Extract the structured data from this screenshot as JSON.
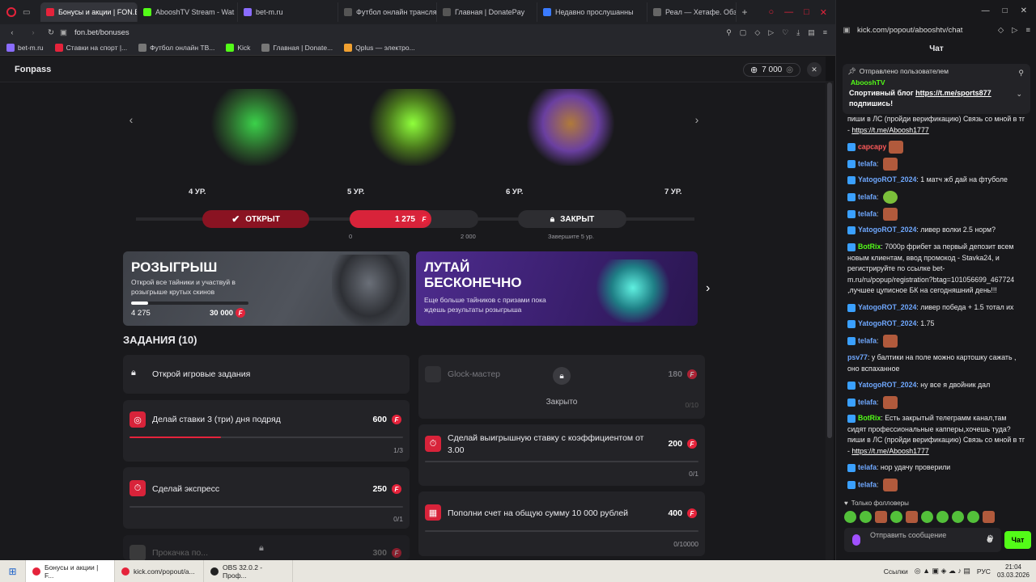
{
  "browser_tabs": [
    {
      "label": "Бонусы и акции | FON.BE",
      "color": "#e5233b",
      "active": true
    },
    {
      "label": "AbooshTV Stream - Wat",
      "color": "#53fc18"
    },
    {
      "label": "bet-m.ru",
      "color": "#8a6cff"
    },
    {
      "label": "Футбол онлайн трансля",
      "color": "#2c2d32"
    },
    {
      "label": "Главная | DonatePay",
      "color": "#2c2d32"
    },
    {
      "label": "Недавно прослушанны",
      "color": "#3a7bff"
    },
    {
      "label": "Реал — Хетафе. Обзор и",
      "color": "#444"
    }
  ],
  "url": "fon.bet/bonuses",
  "bookmarks": [
    "bet-m.ru",
    "Ставки на спорт |...",
    "Футбол онлайн ТВ...",
    "Kick",
    "Главная | Donate...",
    "Qplus — электро..."
  ],
  "page": {
    "title": "Fonpass",
    "balance": "7 000",
    "levels": [
      "4 УР.",
      "5 УР.",
      "6 УР.",
      "7 УР."
    ],
    "opened_label": "ОТКРЫТ",
    "current_points": "1 275",
    "closed_label": "ЗАКРЫТ",
    "range_min": "0",
    "range_max": "2 000",
    "closed_hint": "Завершите 5 ур.",
    "banner1": {
      "title": "РОЗЫГРЫШ",
      "text": "Открой все тайники и участвуй в розыгрыше крутых скинов",
      "progress_value": "4 275",
      "progress_max": "30 000",
      "progress_fraction": 0.1425
    },
    "banner2": {
      "title1": "ЛУТАЙ",
      "title2": "БЕСКОНЕЧНО",
      "text": "Еще больше тайников с призами пока ждешь результаты розыгрыша"
    },
    "tasks_title": "ЗАДАНИЯ (10)",
    "unlock_tasks": "Открой игровые задания",
    "locked_task": {
      "title": "Glock-мастер",
      "points": "180",
      "status": "Закрыто",
      "count": "0/10"
    },
    "tasks": [
      {
        "title": "Делай ставки 3 (три) дня подряд",
        "points": "600",
        "count": "1/3",
        "fraction": 0.333
      },
      {
        "title": "Сделай выигрышную ставку с коэффициентом от 3.00",
        "points": "200",
        "count": "0/1",
        "fraction": 0
      },
      {
        "title": "Сделай экспресс",
        "points": "250",
        "count": "0/1",
        "fraction": 0
      },
      {
        "title": "Пополни счет на общую сумму 10 000 рублей",
        "points": "400",
        "count": "0/10000",
        "fraction": 0
      },
      {
        "title": "Прокачка по...",
        "points": "300"
      }
    ]
  },
  "chat": {
    "url": "kick.com/popout/abooshtv/chat",
    "header": "Чат",
    "pinned_by": "Отправлено пользователем",
    "pinned_user": "AbooshTV",
    "pinned_text": "Спортивный блог ",
    "pinned_link": "https://t.me/sports877",
    "pinned_text2": "подпишись!",
    "top_text": "пиши в ЛС (пройди верификацию) Связь со мной в тг - ",
    "top_link": "https://t.me/Aboosh1777",
    "messages": [
      {
        "user": "capcapy",
        "text": ""
      },
      {
        "user": "telafa",
        "text": ""
      },
      {
        "user": "YatogoROT_2024",
        "text": "1 матч жб дай на фтуболе"
      },
      {
        "user": "telafa",
        "text": ""
      },
      {
        "user": "telafa",
        "text": ""
      },
      {
        "user": "YatogoROT_2024",
        "text": "ливер волки 2.5 норм?"
      },
      {
        "user": "BotRix",
        "text": "7000р фрибет за первый депозит всем новым клиентам, ввод промокод - Stavka24, и регистрируйте по ссылке bet-m.ru/ru/popup/registration?btag=101056699_467724 ,лучшее цуписное БК на сегодняшний день!!!"
      },
      {
        "user": "YatogoROT_2024",
        "text": "ливер победа + 1.5 тотал их"
      },
      {
        "user": "YatogoROT_2024",
        "text": "1.75"
      },
      {
        "user": "telafa",
        "text": ""
      },
      {
        "user": "psv77",
        "text": "у балтики на поле можно картошку сажать , оно вспаханное"
      },
      {
        "user": "YatogoROT_2024",
        "text": "ну все я двойник дал"
      },
      {
        "user": "telafa",
        "text": ""
      },
      {
        "user": "BotRix",
        "text": "Есть закрытый телеграмм канал,там сидят профессиональные капперы,хочешь туда? пиши в ЛС (пройди верификацию) Связь со мной в тг - ",
        "link": "https://t.me/Aboosh1777"
      },
      {
        "user": "telafa",
        "text": "нор удачу проверили"
      },
      {
        "user": "telafa",
        "text": ""
      }
    ],
    "followers_only": "Только фолловеры",
    "input_placeholder": "Отправить сообщение",
    "send_label": "Чат"
  },
  "taskbar": {
    "items": [
      "Бонусы и акции | F...",
      "kick.com/popout/a...",
      "OBS 32.0.2 - Проф..."
    ],
    "links": "Ссылки",
    "lang": "РУС",
    "time": "21:04",
    "date": "03.03.2026"
  }
}
